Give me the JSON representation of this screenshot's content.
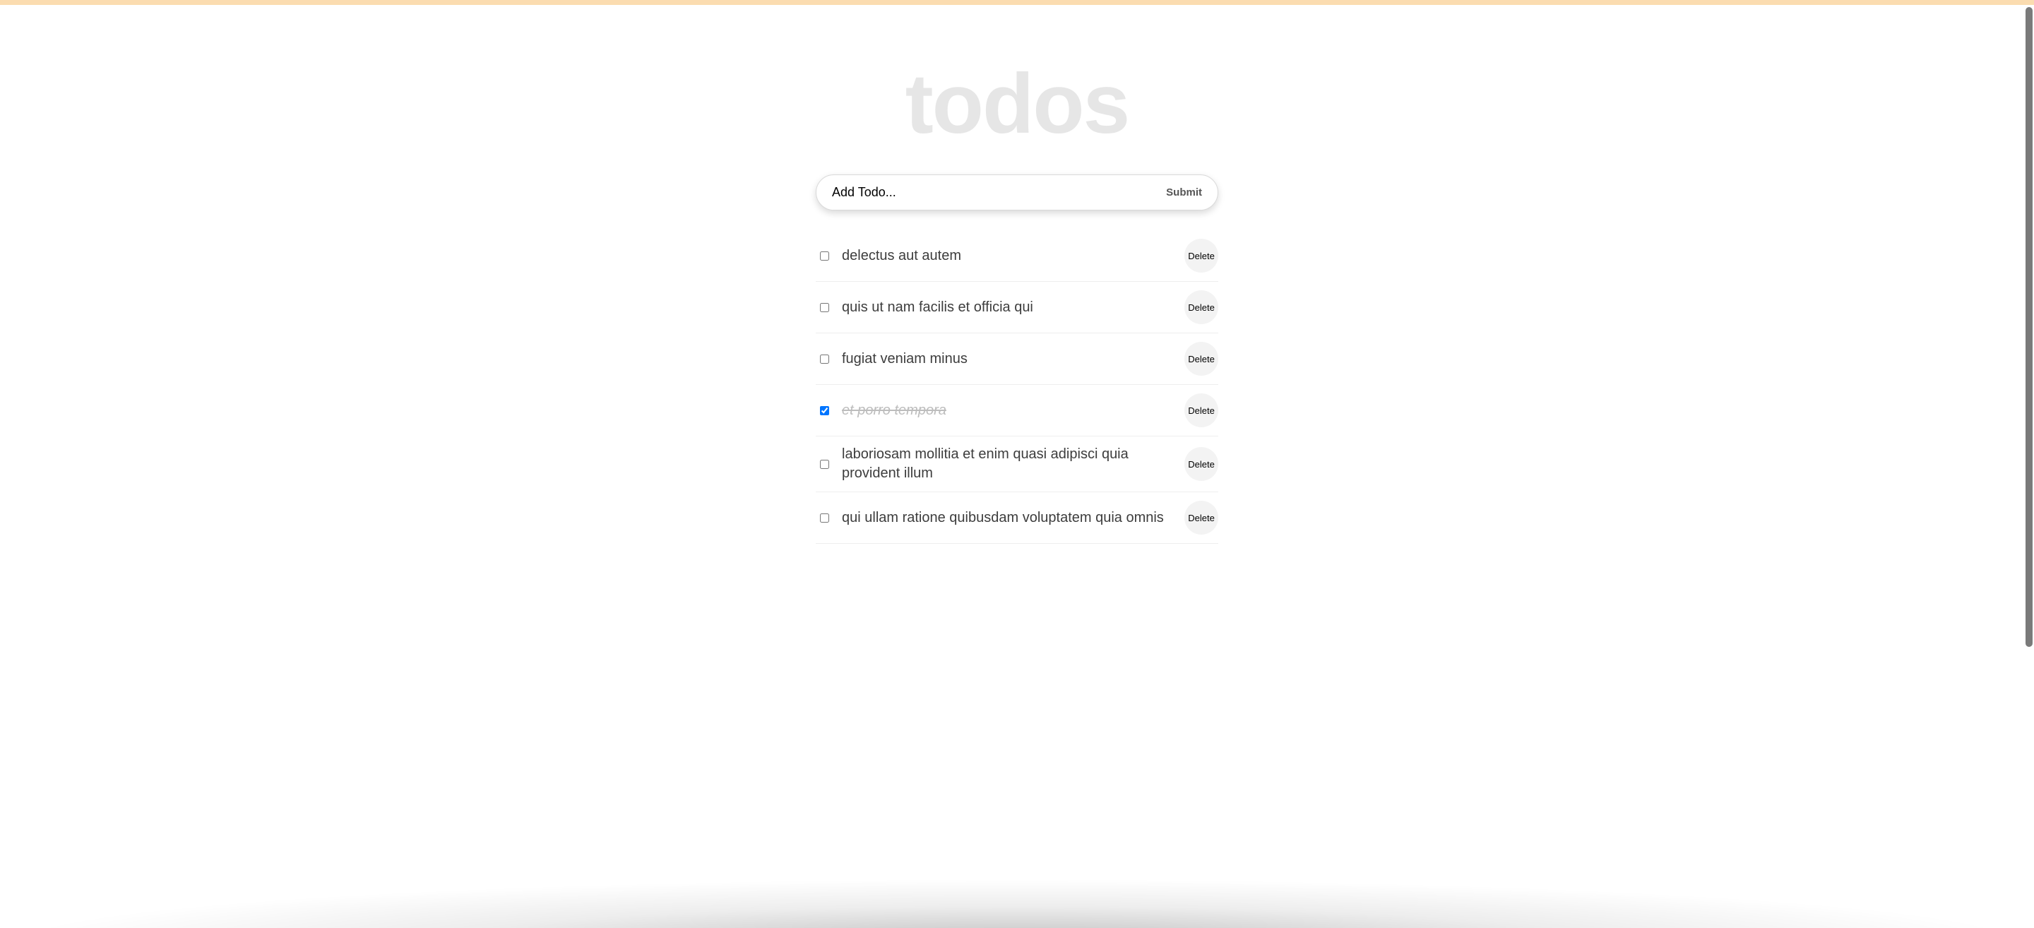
{
  "title": "todos",
  "form": {
    "placeholder": "Add Todo...",
    "submit_label": "Submit"
  },
  "delete_label": "Delete",
  "todos": [
    {
      "text": "delectus aut autem",
      "completed": false
    },
    {
      "text": "quis ut nam facilis et officia qui",
      "completed": false
    },
    {
      "text": "fugiat veniam minus",
      "completed": false
    },
    {
      "text": "et porro tempora",
      "completed": true
    },
    {
      "text": "laboriosam mollitia et enim quasi adipisci quia provident illum",
      "completed": false
    },
    {
      "text": "qui ullam ratione quibusdam voluptatem quia omnis",
      "completed": false
    }
  ]
}
